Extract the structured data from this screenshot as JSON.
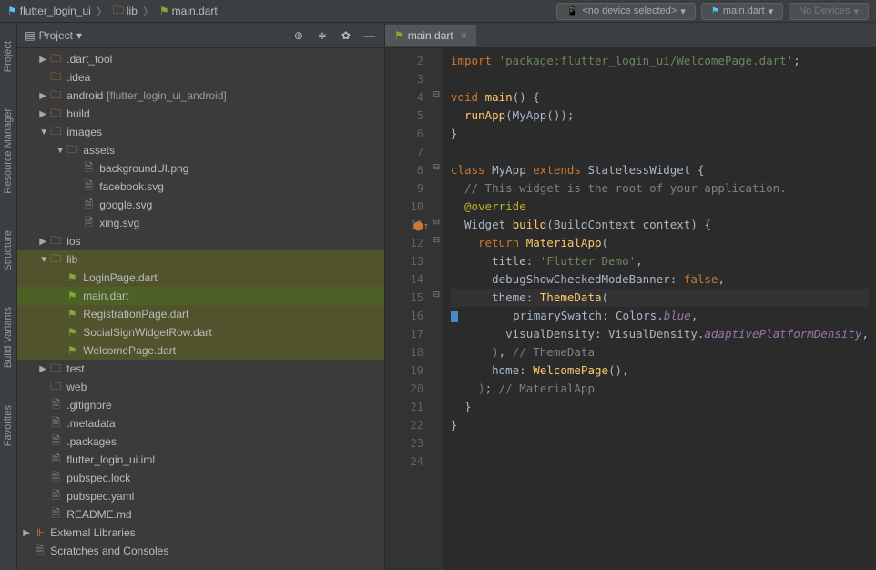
{
  "breadcrumb": {
    "project": "flutter_login_ui",
    "folder": "lib",
    "file": "main.dart"
  },
  "topbar": {
    "device_selector": "<no device selected>",
    "config_selector": "main.dart",
    "targets": "No Devices"
  },
  "project_panel": {
    "title": "Project",
    "left_tools": [
      "Project",
      "Resource Manager",
      "Structure",
      "Build Variants",
      "Favorites"
    ]
  },
  "tree": [
    {
      "indent": 1,
      "arrow": "▶",
      "icon": "folder-orange",
      "label": ".dart_tool"
    },
    {
      "indent": 1,
      "arrow": "",
      "icon": "folder-orange",
      "label": ".idea"
    },
    {
      "indent": 1,
      "arrow": "▶",
      "icon": "folder-orange",
      "label": "android",
      "mod": "[flutter_login_ui_android]"
    },
    {
      "indent": 1,
      "arrow": "▶",
      "icon": "folder-orange",
      "label": "build"
    },
    {
      "indent": 1,
      "arrow": "▼",
      "icon": "folder-gray",
      "label": "images"
    },
    {
      "indent": 2,
      "arrow": "▼",
      "icon": "folder-gray",
      "label": "assets"
    },
    {
      "indent": 3,
      "arrow": "",
      "icon": "file-gray",
      "label": "backgroundUI.png"
    },
    {
      "indent": 3,
      "arrow": "",
      "icon": "file-gray",
      "label": "facebook.svg"
    },
    {
      "indent": 3,
      "arrow": "",
      "icon": "file-gray",
      "label": "google.svg"
    },
    {
      "indent": 3,
      "arrow": "",
      "icon": "file-gray",
      "label": "xing.svg"
    },
    {
      "indent": 1,
      "arrow": "▶",
      "icon": "folder-gray",
      "label": "ios"
    },
    {
      "indent": 1,
      "arrow": "▼",
      "icon": "folder-lime",
      "label": "lib",
      "hl": true
    },
    {
      "indent": 2,
      "arrow": "",
      "icon": "dart-green",
      "label": "LoginPage.dart",
      "hl": true
    },
    {
      "indent": 2,
      "arrow": "",
      "icon": "dart-green",
      "label": "main.dart",
      "hl": true,
      "selected": true
    },
    {
      "indent": 2,
      "arrow": "",
      "icon": "dart-green",
      "label": "RegistrationPage.dart",
      "hl": true
    },
    {
      "indent": 2,
      "arrow": "",
      "icon": "dart-green",
      "label": "SocialSignWidgetRow.dart",
      "hl": true
    },
    {
      "indent": 2,
      "arrow": "",
      "icon": "dart-green",
      "label": "WelcomePage.dart",
      "hl": true
    },
    {
      "indent": 1,
      "arrow": "▶",
      "icon": "folder-lime",
      "label": "test"
    },
    {
      "indent": 1,
      "arrow": "",
      "icon": "folder-gray",
      "label": "web"
    },
    {
      "indent": 1,
      "arrow": "",
      "icon": "file-gray",
      "label": ".gitignore"
    },
    {
      "indent": 1,
      "arrow": "",
      "icon": "file-gray",
      "label": ".metadata"
    },
    {
      "indent": 1,
      "arrow": "",
      "icon": "file-gray",
      "label": ".packages"
    },
    {
      "indent": 1,
      "arrow": "",
      "icon": "file-gray",
      "label": "flutter_login_ui.iml"
    },
    {
      "indent": 1,
      "arrow": "",
      "icon": "file-gray",
      "label": "pubspec.lock"
    },
    {
      "indent": 1,
      "arrow": "",
      "icon": "file-gray",
      "label": "pubspec.yaml"
    },
    {
      "indent": 1,
      "arrow": "",
      "icon": "file-gray",
      "label": "README.md"
    },
    {
      "indent": 0,
      "arrow": "▶",
      "icon": "lib-icon",
      "label": "External Libraries"
    },
    {
      "indent": 0,
      "arrow": "",
      "icon": "file-gray",
      "label": "Scratches and Consoles"
    }
  ],
  "editor": {
    "tab": "main.dart",
    "lines_start": 2,
    "lines_end": 24,
    "current_line": 15,
    "code": [
      {
        "n": 2,
        "html": "<span class='kw'>import</span> <span class='str'>'package:flutter_login_ui/WelcomePage.dart'</span>;"
      },
      {
        "n": 3,
        "html": ""
      },
      {
        "n": 4,
        "html": "<span class='kw'>void</span> <span class='fname'>main</span>() {"
      },
      {
        "n": 5,
        "html": "  <span class='fname'>runApp</span>(MyApp());"
      },
      {
        "n": 6,
        "html": "}"
      },
      {
        "n": 7,
        "html": ""
      },
      {
        "n": 8,
        "html": "<span class='kw'>class</span> <span class='cls'>MyApp</span> <span class='kw'>extends</span> StatelessWidget {"
      },
      {
        "n": 9,
        "html": "  <span class='comment'>// This widget is the root of your application.</span>"
      },
      {
        "n": 10,
        "html": "  <span class='ann'>@override</span>"
      },
      {
        "n": 11,
        "html": "  Widget <span class='fname'>build</span>(BuildContext context) {"
      },
      {
        "n": 12,
        "html": "    <span class='kw'>return</span> <span class='fname'>MaterialApp</span>("
      },
      {
        "n": 13,
        "html": "      title: <span class='str'>'Flutter Demo'</span>,"
      },
      {
        "n": 14,
        "html": "      debugShowCheckedModeBanner: <span class='kw'>false</span>,"
      },
      {
        "n": 15,
        "html": "      theme: <span class='fname'>ThemeData</span>("
      },
      {
        "n": 16,
        "html": "        primarySwatch: Colors.<span class='ital'>blue</span>,"
      },
      {
        "n": 17,
        "html": "        visualDensity: VisualDensity.<span class='ital'>adaptivePlatformDensity</span>,"
      },
      {
        "n": 18,
        "html": "      <span class='closer'>)</span>, <span class='comment'>// ThemeData</span>"
      },
      {
        "n": 19,
        "html": "      home: <span class='fname'>WelcomePage</span>(),"
      },
      {
        "n": 20,
        "html": "    <span class='closer'>)</span>; <span class='comment'>// MaterialApp</span>"
      },
      {
        "n": 21,
        "html": "  }"
      },
      {
        "n": 22,
        "html": "}"
      },
      {
        "n": 23,
        "html": ""
      },
      {
        "n": 24,
        "html": ""
      }
    ]
  }
}
